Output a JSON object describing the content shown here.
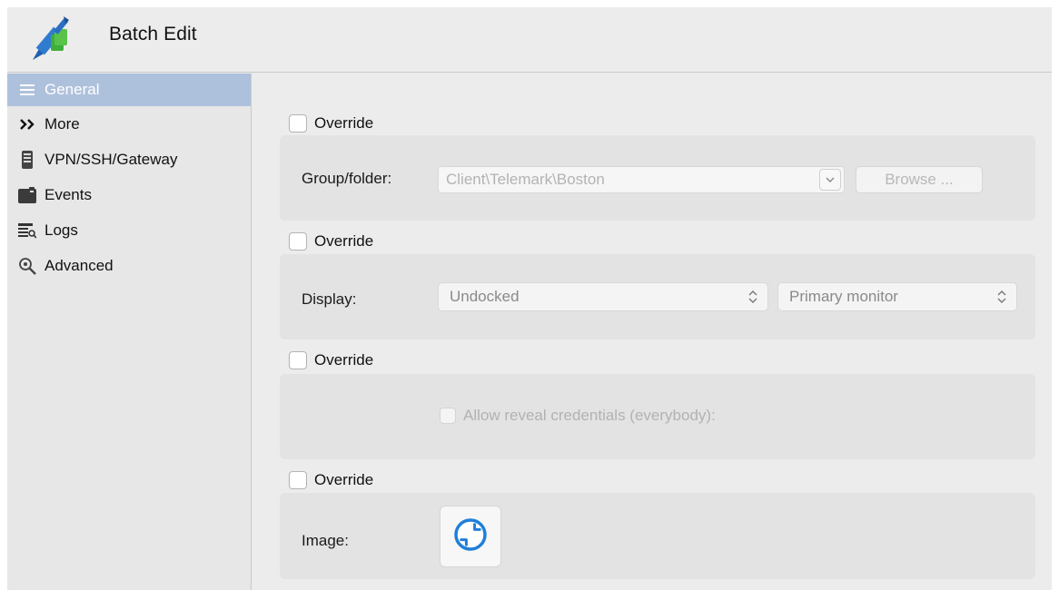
{
  "window": {
    "title": "Batch Edit"
  },
  "sidebar": {
    "items": [
      {
        "label": "General",
        "icon": "list-icon",
        "active": true
      },
      {
        "label": "More",
        "icon": "double-chevron-icon"
      },
      {
        "label": "VPN/SSH/Gateway",
        "icon": "server-icon"
      },
      {
        "label": "Events",
        "icon": "folder-icon"
      },
      {
        "label": "Logs",
        "icon": "log-icon"
      },
      {
        "label": "Advanced",
        "icon": "search-gear-icon"
      }
    ]
  },
  "content": {
    "override_label": "Override",
    "group": {
      "label": "Group/folder:",
      "value": "Client\\Telemark\\Boston",
      "browse_label": "Browse ..."
    },
    "display": {
      "label": "Display:",
      "mode_value": "Undocked",
      "monitor_value": "Primary monitor"
    },
    "credentials": {
      "checkbox_label": "Allow reveal credentials (everybody):"
    },
    "image": {
      "label": "Image:",
      "icon": "remote-desktop-icon"
    }
  },
  "colors": {
    "accent": "#aec1dc",
    "icon_blue": "#1e7fd9",
    "panel": "#e3e3e3",
    "background": "#ececec"
  }
}
